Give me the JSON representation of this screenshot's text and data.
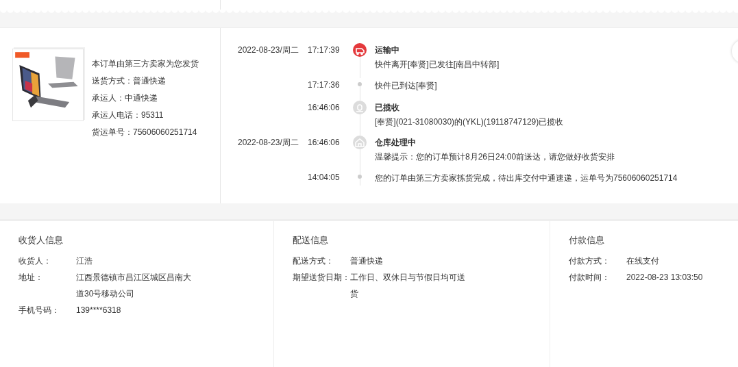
{
  "order_info": {
    "lines": [
      "本订单由第三方卖家为您发货",
      "送货方式：普通快递",
      "承运人：中通快递",
      "承运人电话：95311",
      "货运单号：75606060251714"
    ]
  },
  "timeline": [
    {
      "kind": "transit",
      "active": true,
      "date": "2022-08-23/周二",
      "time": "17:17:39",
      "title": "运输中",
      "text": "快件离开[奉贤]已发往[南昌中转部]"
    },
    {
      "kind": "step",
      "time": "17:17:36",
      "text": "快件已到达[奉贤]"
    },
    {
      "kind": "pickup",
      "active": false,
      "time": "16:46:06",
      "title": "已揽收",
      "text": "[奉贤](021-31080030)的(YKL)(19118747129)已揽收"
    },
    {
      "kind": "warehouse",
      "active": false,
      "date": "2022-08-23/周二",
      "time": "16:46:06",
      "title": "仓库处理中",
      "text": "温馨提示：您的订单预计8月26日24:00前送达，请您做好收货安排"
    },
    {
      "kind": "step",
      "time": "14:04:05",
      "text": "您的订单由第三方卖家拣货完成，待出库交付中通速递，运单号为75606060251714"
    }
  ],
  "sections": [
    {
      "title": "收货人信息",
      "rows": [
        {
          "label": "收货人：",
          "value": "江浩"
        },
        {
          "label": "地址：",
          "value": "江西景德镇市昌江区城区昌南大道30号移动公司"
        },
        {
          "label": "手机号码：",
          "value": "139****6318"
        }
      ]
    },
    {
      "title": "配送信息",
      "rows": [
        {
          "label": "配送方式：",
          "value": "普通快递"
        },
        {
          "label": "期望送货日期：",
          "value": "工作日、双休日与节假日均可送货"
        }
      ]
    },
    {
      "title": "付款信息",
      "rows": [
        {
          "label": "付款方式：",
          "value": "在线支付"
        },
        {
          "label": "付款时间：",
          "value": "2022-08-23 13:03:50"
        }
      ]
    }
  ]
}
